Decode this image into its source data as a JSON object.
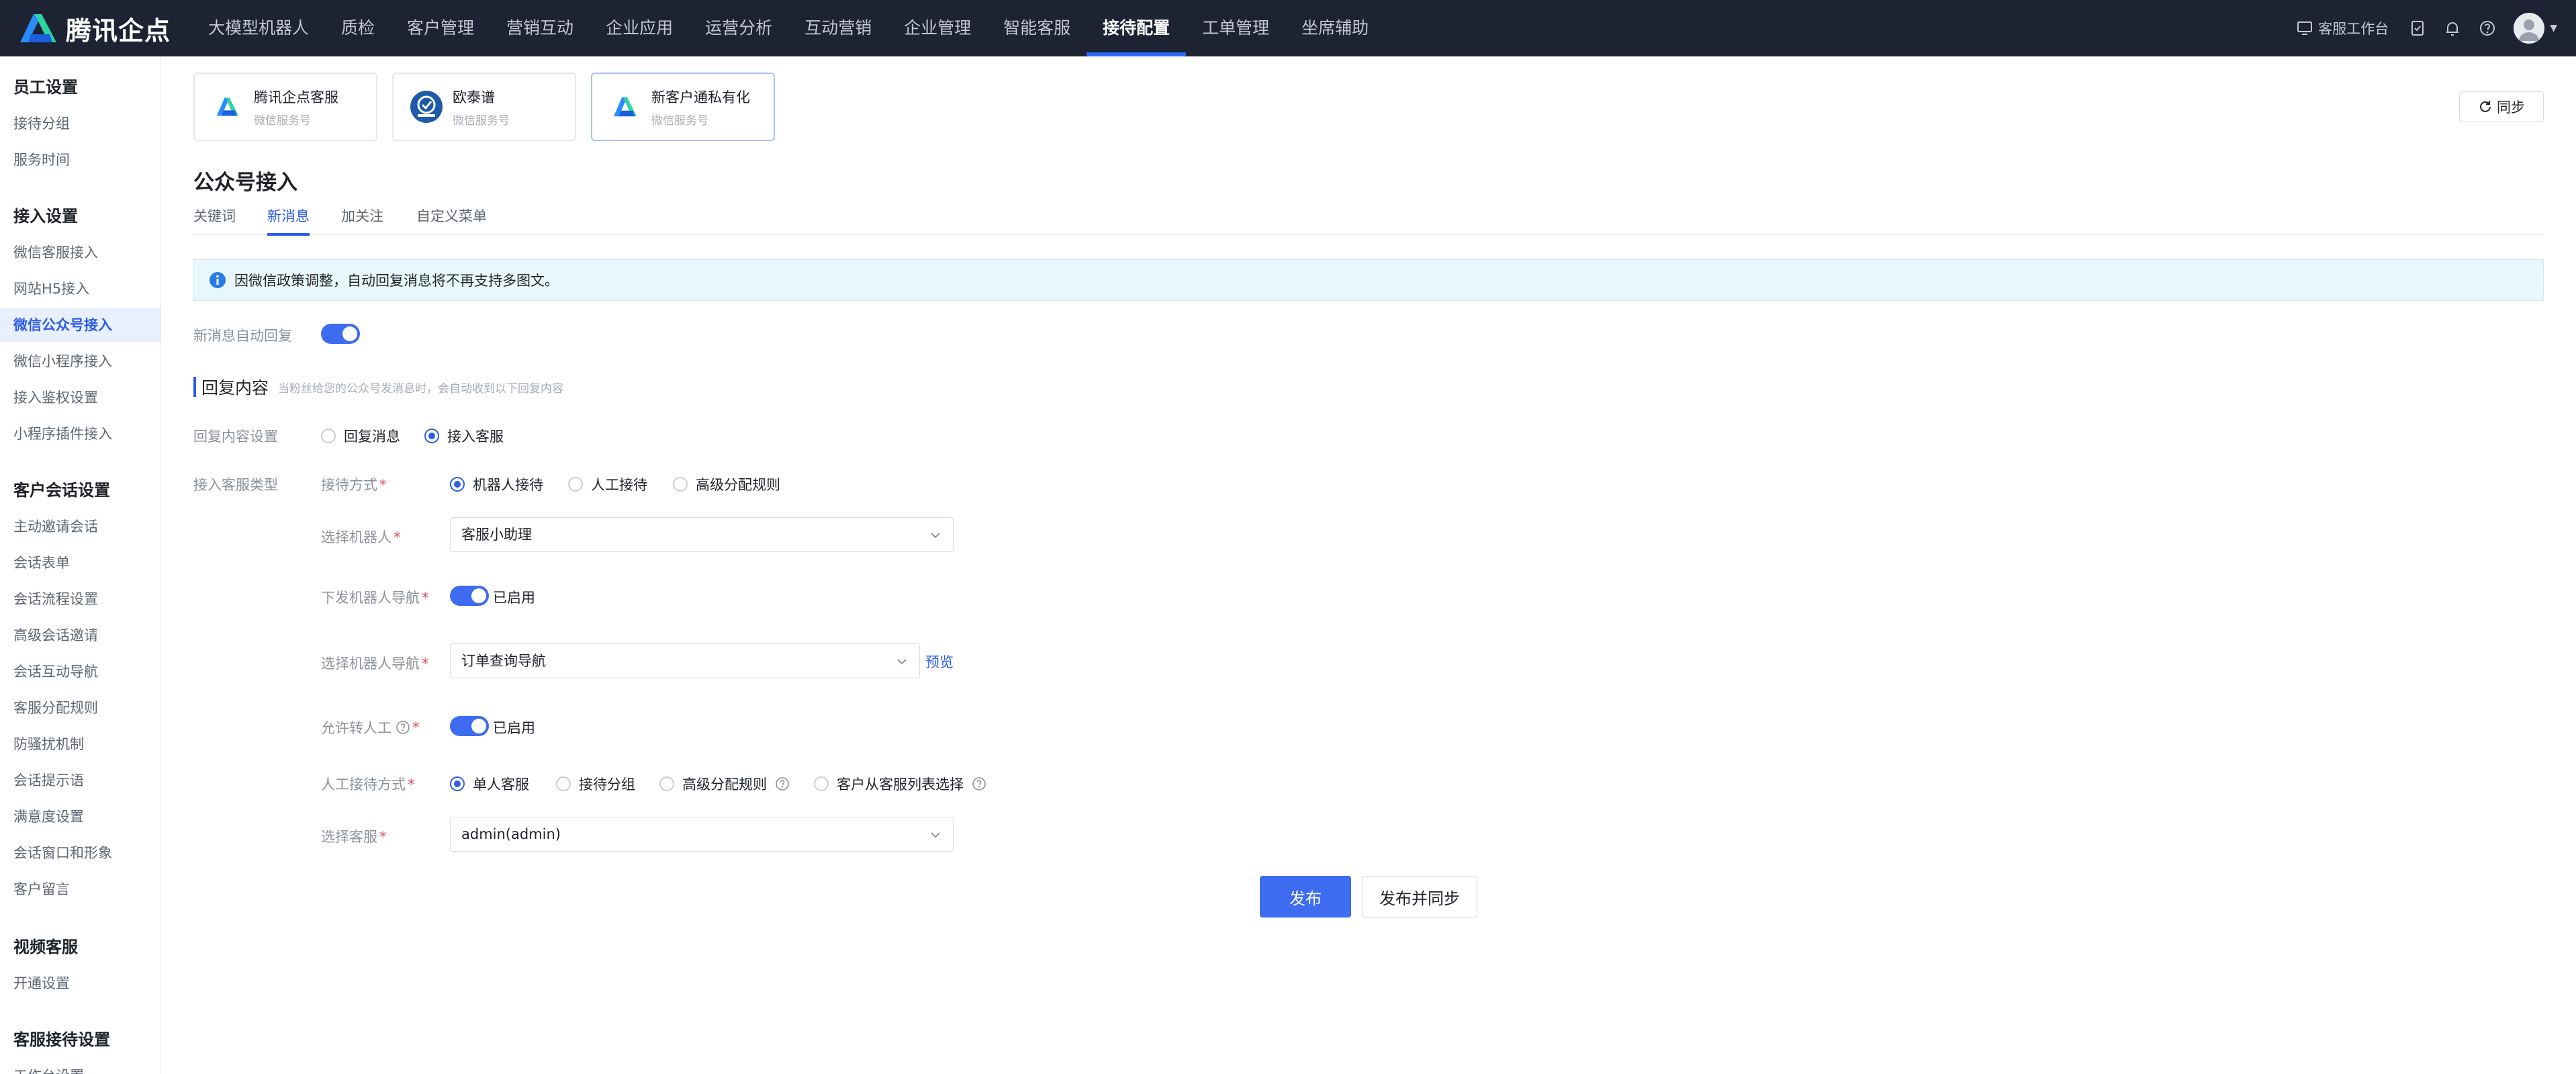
{
  "brand": {
    "name": "腾讯企点"
  },
  "nav": {
    "items": [
      "大模型机器人",
      "质检",
      "客户管理",
      "营销互动",
      "企业应用",
      "运营分析",
      "互动营销",
      "企业管理",
      "智能客服",
      "接待配置",
      "工单管理",
      "坐席辅助"
    ],
    "active_index": 9
  },
  "topright": {
    "workspace_label": "客服工作台",
    "icons": [
      "monitor-icon",
      "task-check-icon",
      "bell-icon",
      "help-circle-icon",
      "avatar"
    ]
  },
  "sidebar": {
    "sections": [
      {
        "title": "员工设置",
        "items": [
          "接待分组",
          "服务时间"
        ]
      },
      {
        "title": "接入设置",
        "items": [
          "微信客服接入",
          "网站H5接入",
          "微信公众号接入",
          "微信小程序接入",
          "接入鉴权设置",
          "小程序插件接入"
        ]
      },
      {
        "title": "客户会话设置",
        "items": [
          "主动邀请会话",
          "会话表单",
          "会话流程设置",
          "高级会话邀请",
          "会话互动导航",
          "客服分配规则",
          "防骚扰机制",
          "会话提示语",
          "满意度设置",
          "会话窗口和形象",
          "客户留言"
        ]
      },
      {
        "title": "视频客服",
        "items": [
          "开通设置"
        ]
      },
      {
        "title": "客服接待设置",
        "items": [
          "工作台设置"
        ]
      }
    ],
    "active_item": "微信公众号接入"
  },
  "accounts": [
    {
      "name": "腾讯企点客服",
      "type": "微信服务号",
      "logo": "qidian-logo"
    },
    {
      "name": "欧泰谱",
      "type": "微信服务号",
      "logo": "otp-logo"
    },
    {
      "name": "新客户通私有化",
      "type": "微信服务号",
      "logo": "qidian-logo"
    }
  ],
  "sync_label": "同步",
  "page_title": "公众号接入",
  "tabs": [
    "关键词",
    "新消息",
    "加关注",
    "自定义菜单"
  ],
  "active_tab": 1,
  "notice": "因微信政策调整，自动回复消息将不再支持多图文。",
  "form": {
    "auto_reply_label": "新消息自动回复",
    "auto_reply_on": true,
    "section_title": "回复内容",
    "section_desc": "当粉丝给您的公众号发消息时，会自动收到以下回复内容",
    "reply_setting_label": "回复内容设置",
    "reply_options": [
      "回复消息",
      "接入客服"
    ],
    "reply_selected": 1,
    "access_type_label": "接入客服类型",
    "reception_mode_label": "接待方式",
    "reception_options": [
      "机器人接待",
      "人工接待",
      "高级分配规则"
    ],
    "reception_selected": 0,
    "robot_label": "选择机器人",
    "robot_value": "客服小助理",
    "robot_nav_label": "下发机器人导航",
    "robot_nav_status": "已启用",
    "robot_nav_on": true,
    "select_nav_label": "选择机器人导航",
    "select_nav_value": "订单查询导航",
    "preview_label": "预览",
    "allow_transfer_label": "允许转人工",
    "allow_transfer_status": "已启用",
    "allow_transfer_on": true,
    "manual_mode_label": "人工接待方式",
    "manual_options": [
      "单人客服",
      "接待分组",
      "高级分配规则",
      "客户从客服列表选择"
    ],
    "manual_selected": 0,
    "agent_label": "选择客服",
    "agent_value": "admin(admin)"
  },
  "buttons": {
    "publish": "发布",
    "publish_sync": "发布并同步"
  },
  "colors": {
    "topbar": "#1d2333",
    "accent": "#2b5ce6",
    "primary_button": "#3d6cf0",
    "notice_bg": "#e8f7fd"
  }
}
